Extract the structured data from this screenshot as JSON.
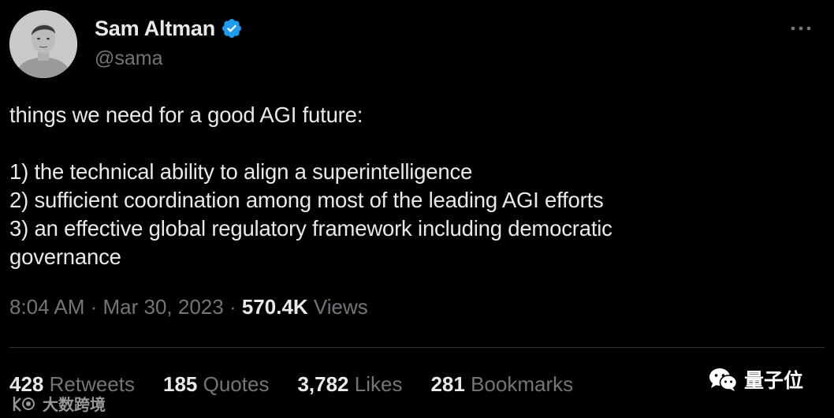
{
  "author": {
    "display_name": "Sam Altman",
    "handle": "@sama",
    "verified": true
  },
  "tweet": {
    "intro": "things we need for a good AGI future:",
    "points": [
      "1) the technical ability to align a superintelligence",
      "2) sufficient coordination among most of the leading AGI efforts",
      "3) an effective global regulatory framework including democratic governance"
    ]
  },
  "meta": {
    "time": "8:04 AM",
    "sep1": " · ",
    "date": "Mar 30, 2023",
    "sep2": " · ",
    "views_count": "570.4K",
    "views_label": " Views"
  },
  "stats": [
    {
      "num": "428",
      "label": " Retweets"
    },
    {
      "num": "185",
      "label": " Quotes"
    },
    {
      "num": "3,782",
      "label": " Likes"
    },
    {
      "num": "281",
      "label": " Bookmarks"
    }
  ],
  "watermarks": {
    "left": "大数跨境",
    "right": "量子位"
  },
  "colors": {
    "background": "#000000",
    "text": "#e7e9ea",
    "secondary": "#71767b",
    "verified": "#1d9bf0",
    "divider": "#2f3336"
  },
  "icons": {
    "verified": "verified-badge-icon",
    "more": "more-horizontal-icon",
    "wechat": "wechat-logo-icon",
    "wm_left_logo": "watermark-logo-icon"
  }
}
